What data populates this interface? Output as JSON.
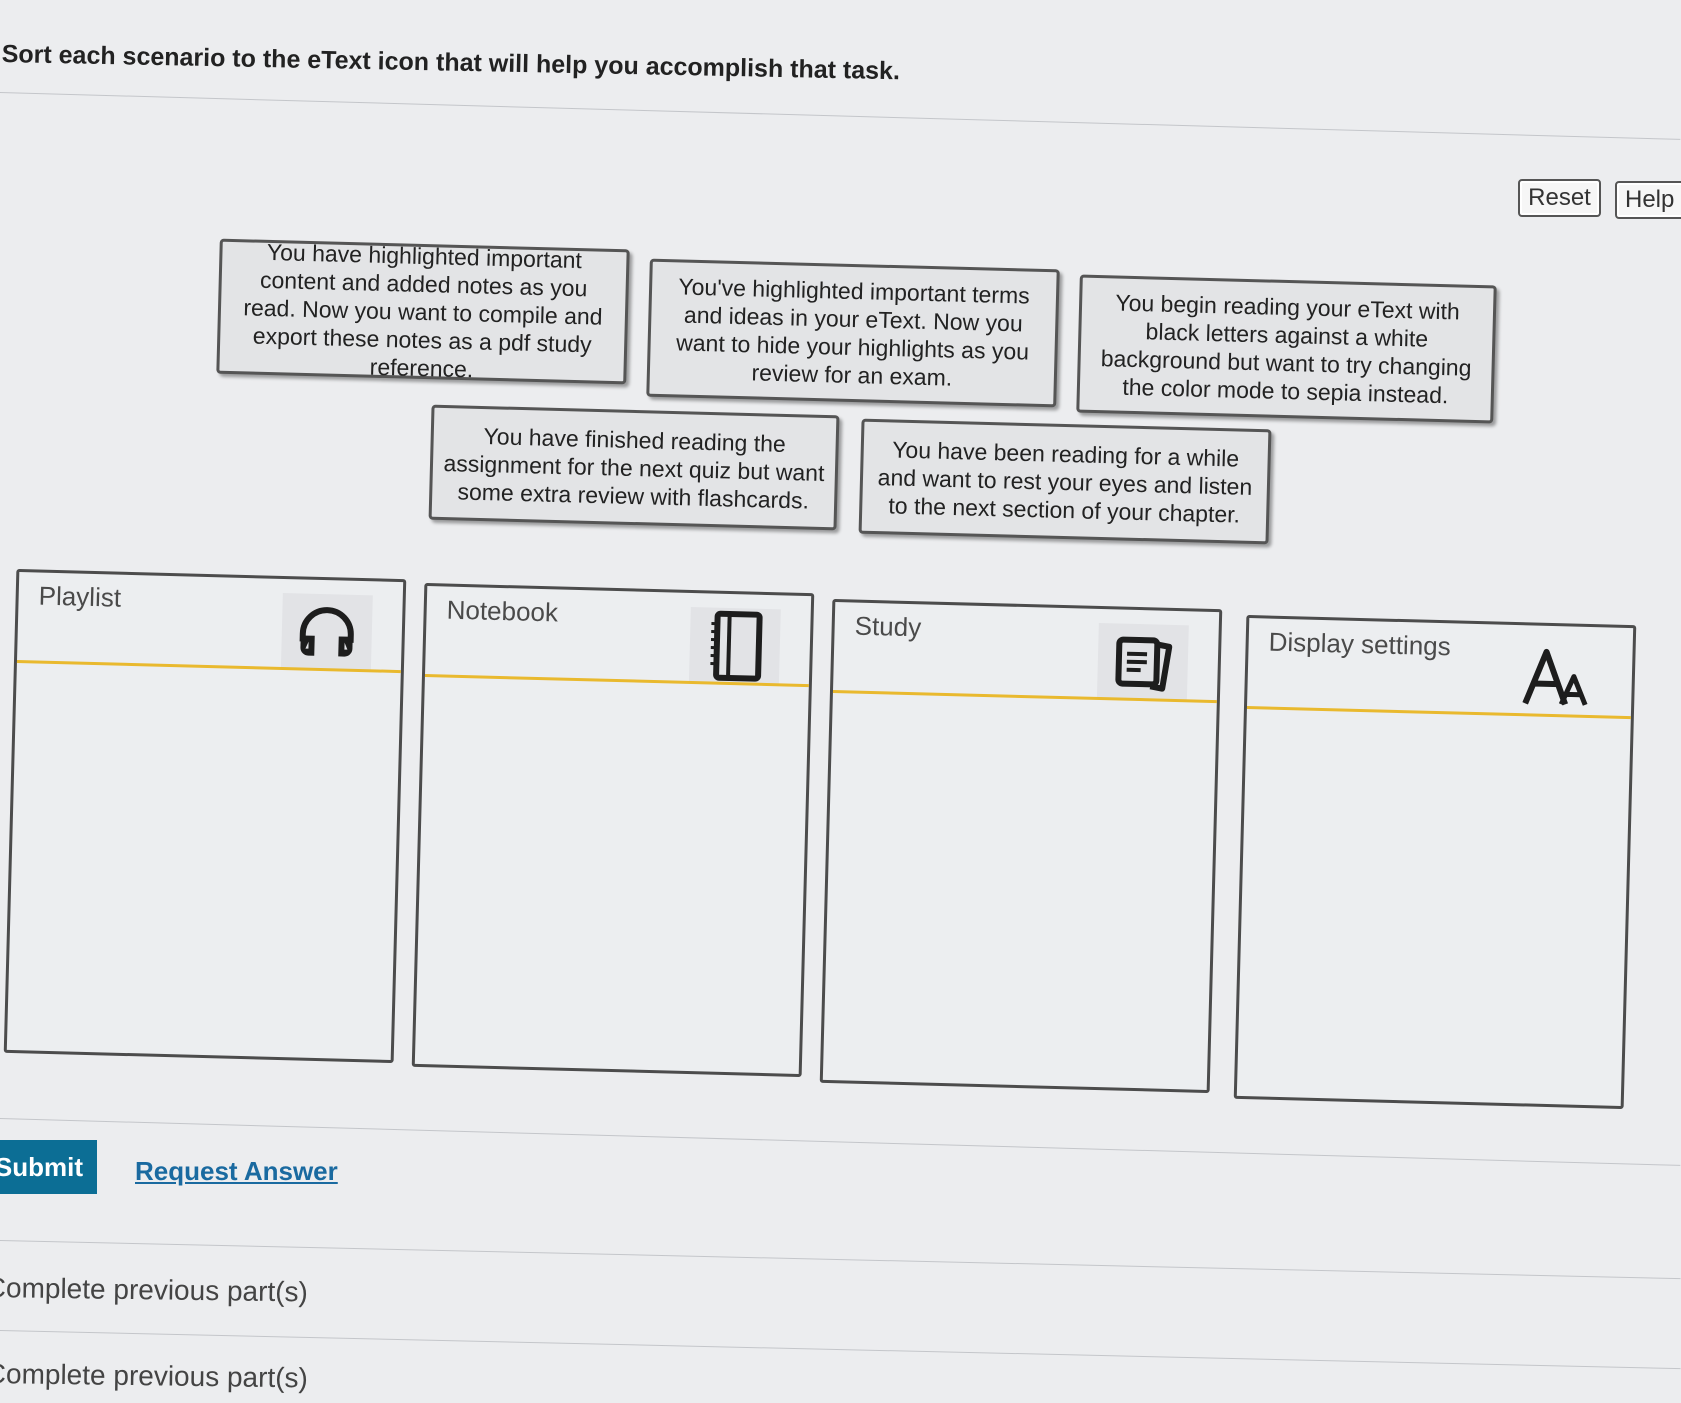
{
  "instruction": "Sort each scenario to the eText icon that will help you accomplish that task.",
  "buttons": {
    "reset": "Reset",
    "help": "Help"
  },
  "tiles": [
    "You have highlighted important content and added notes as you read. Now you want to compile and export these notes as a pdf study reference.",
    "You've highlighted important terms and ideas in your eText. Now you want to hide your highlights as you review for an exam.",
    "You begin reading your eText with black letters against a white background but want to try changing the color mode to sepia instead.",
    "You have finished reading the assignment for the next quiz but want some extra review with flashcards.",
    "You have been reading for a while and want to rest your eyes and listen to the next section of your chapter."
  ],
  "bins": [
    {
      "title": "Playlist",
      "icon": "headphones-icon"
    },
    {
      "title": "Notebook",
      "icon": "notebook-icon"
    },
    {
      "title": "Study",
      "icon": "study-cards-icon"
    },
    {
      "title": "Display settings",
      "icon": "text-size-icon"
    }
  ],
  "footer": {
    "submit": "Submit",
    "request_answer": "Request Answer",
    "previous_1": "Complete previous part(s)",
    "previous_2": "Complete previous part(s)"
  },
  "colors": {
    "accent_rule": "#e9b92e",
    "submit_bg": "#0c6e95",
    "link": "#1a6aa0"
  }
}
